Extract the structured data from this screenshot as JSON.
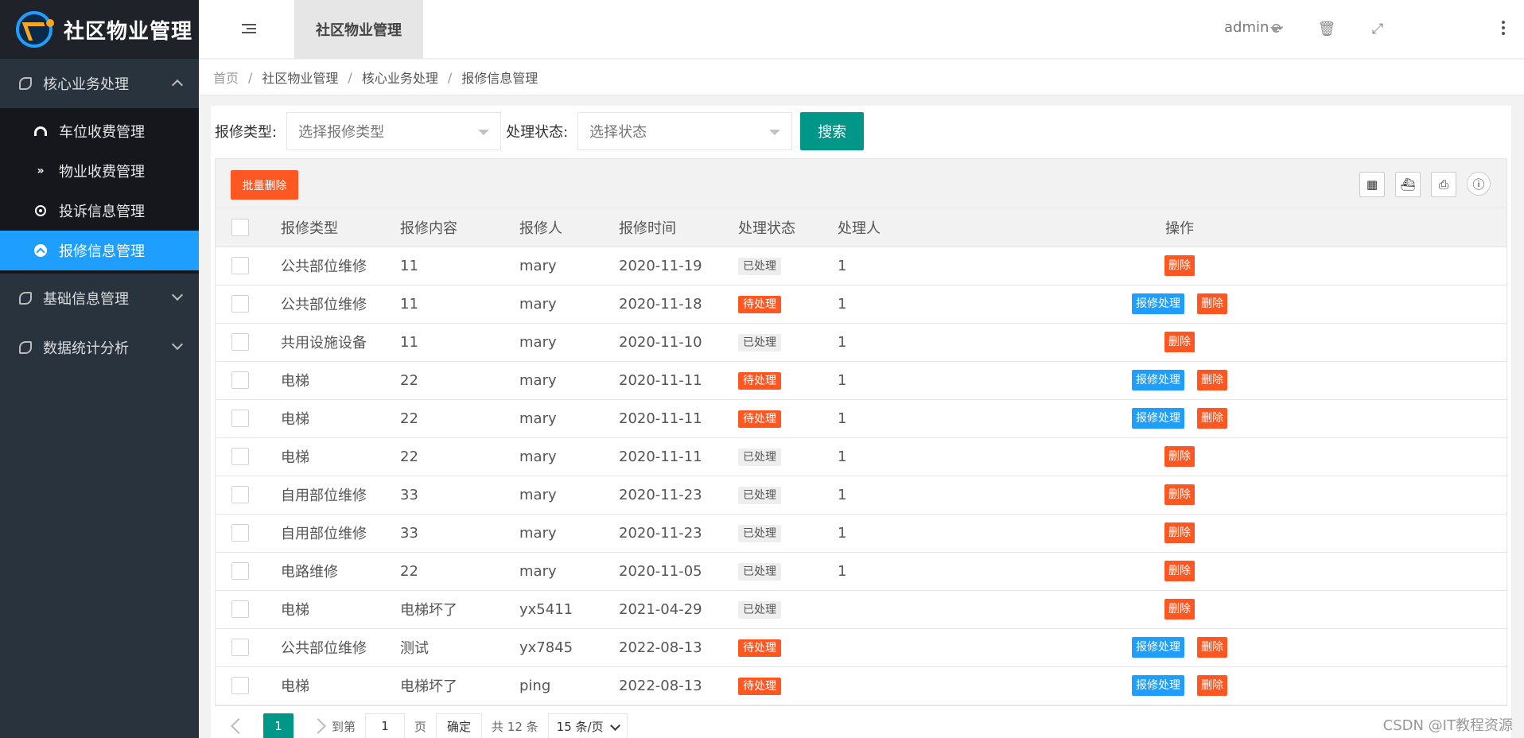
{
  "app": {
    "title": "社区物业管理"
  },
  "sidebar": {
    "groups": [
      {
        "label": "核心业务处理"
      },
      {
        "label": "基础信息管理"
      },
      {
        "label": "数据统计分析"
      }
    ],
    "items": [
      {
        "label": "车位收费管理",
        "icon": "dashboard-icon"
      },
      {
        "label": "物业收费管理",
        "icon": "double-chevron-icon"
      },
      {
        "label": "投诉信息管理",
        "icon": "target-icon"
      },
      {
        "label": "报修信息管理",
        "icon": "up-circle-icon"
      }
    ]
  },
  "header": {
    "tab": "社区物业管理",
    "user": "admin"
  },
  "breadcrumb": [
    "首页",
    "社区物业管理",
    "核心业务处理",
    "报修信息管理"
  ],
  "filters": {
    "type_label": "报修类型:",
    "type_placeholder": "选择报修类型",
    "status_label": "处理状态:",
    "status_placeholder": "选择状态",
    "search_label": "搜索"
  },
  "toolbar": {
    "batch_delete": "批量删除"
  },
  "table": {
    "columns": [
      "报修类型",
      "报修内容",
      "报修人",
      "报修时间",
      "处理状态",
      "处理人",
      "操作"
    ],
    "rows": [
      {
        "type": "公共部位维修",
        "content": "11",
        "reporter": "mary",
        "time": "2020-11-19",
        "status": "已处理",
        "handler": "1"
      },
      {
        "type": "公共部位维修",
        "content": "11",
        "reporter": "mary",
        "time": "2020-11-18",
        "status": "待处理",
        "handler": "1"
      },
      {
        "type": "共用设施设备",
        "content": "11",
        "reporter": "mary",
        "time": "2020-11-10",
        "status": "已处理",
        "handler": "1"
      },
      {
        "type": "电梯",
        "content": "22",
        "reporter": "mary",
        "time": "2020-11-11",
        "status": "待处理",
        "handler": "1"
      },
      {
        "type": "电梯",
        "content": "22",
        "reporter": "mary",
        "time": "2020-11-11",
        "status": "待处理",
        "handler": "1"
      },
      {
        "type": "电梯",
        "content": "22",
        "reporter": "mary",
        "time": "2020-11-11",
        "status": "已处理",
        "handler": "1"
      },
      {
        "type": "自用部位维修",
        "content": "33",
        "reporter": "mary",
        "time": "2020-11-23",
        "status": "已处理",
        "handler": "1"
      },
      {
        "type": "自用部位维修",
        "content": "33",
        "reporter": "mary",
        "time": "2020-11-23",
        "status": "已处理",
        "handler": "1"
      },
      {
        "type": "电路维修",
        "content": "22",
        "reporter": "mary",
        "time": "2020-11-05",
        "status": "已处理",
        "handler": "1"
      },
      {
        "type": "电梯",
        "content": "电梯坏了",
        "reporter": "yx5411",
        "time": "2021-04-29",
        "status": "已处理",
        "handler": ""
      },
      {
        "type": "公共部位维修",
        "content": "测试",
        "reporter": "yx7845",
        "time": "2022-08-13",
        "status": "待处理",
        "handler": ""
      },
      {
        "type": "电梯",
        "content": "电梯坏了",
        "reporter": "ping",
        "time": "2022-08-13",
        "status": "待处理",
        "handler": ""
      }
    ],
    "status_done": "已处理",
    "action_repair": "报修处理",
    "action_delete": "删除"
  },
  "pager": {
    "current": "1",
    "goto_label": "到第",
    "goto_value": "1",
    "page_unit": "页",
    "confirm": "确定",
    "total": "共 12 条",
    "page_size": "15 条/页"
  },
  "watermark": "CSDN @IT教程资源",
  "colors": {
    "primary": "#009688",
    "blue": "#1e9fff",
    "danger": "#ff5722",
    "sidebar": "#28333e"
  }
}
